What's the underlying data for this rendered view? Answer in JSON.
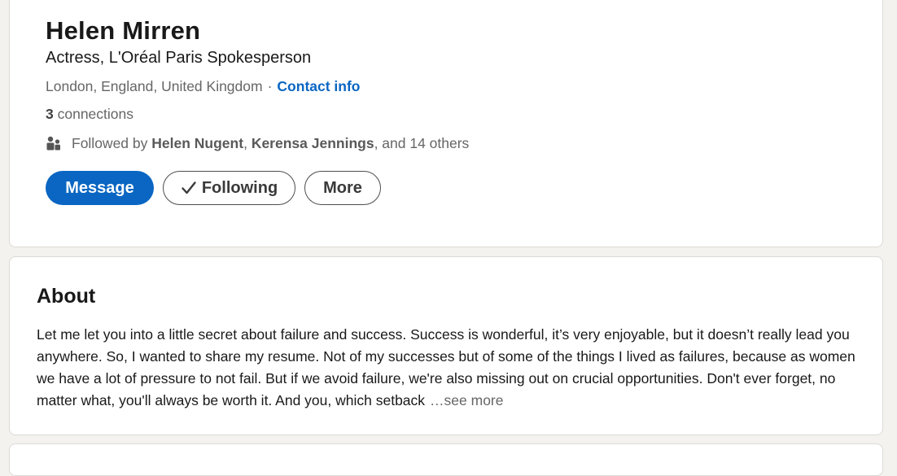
{
  "profile": {
    "name": "Helen Mirren",
    "headline": "Actress, L'Oréal Paris Spokesperson",
    "location": "London, England, United Kingdom",
    "separator": "·",
    "contact_info": "Contact info",
    "connections_count": "3",
    "connections_label": "connections",
    "followed_by_prefix": "Followed by",
    "follower_1": "Helen Nugent",
    "follower_sep": ",",
    "follower_2": "Kerensa Jennings",
    "followed_by_suffix": ", and 14 others",
    "actions": {
      "message": "Message",
      "following": "Following",
      "more": "More"
    }
  },
  "about": {
    "title": "About",
    "text": "Let me let you into a little secret about failure and success. Success is wonderful, it’s very enjoyable, but it doesn’t really lead you anywhere. So, I wanted to share my resume. Not of my successes but of some of the things I lived as failures, because as women we have a lot of pressure to not fail. But if we avoid failure, we're also missing out on crucial opportunities. Don't ever forget, no matter what, you'll always be worth it. And you, which setback",
    "see_more": "…see more"
  },
  "icons": {
    "people": "people-icon",
    "check": "check-icon",
    "corner": "edit-pencil-icon"
  },
  "colors": {
    "accent": "#0a66c2",
    "background": "#f4f2ee"
  }
}
